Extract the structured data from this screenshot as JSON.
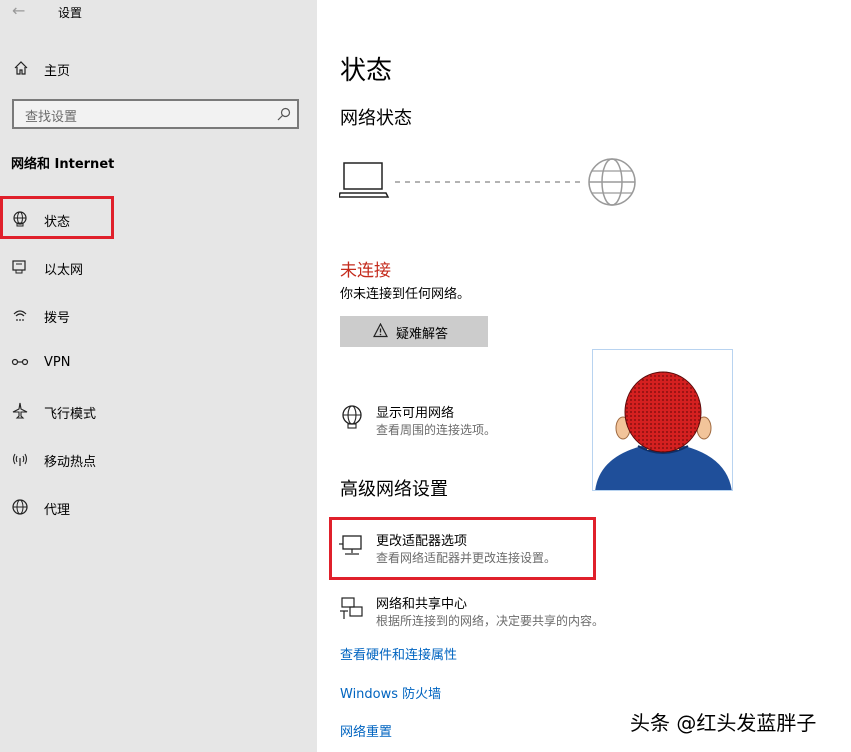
{
  "window": {
    "title": "设置"
  },
  "sidebar": {
    "home_label": "主页",
    "search_placeholder": "查找设置",
    "section_title": "网络和 Internet",
    "items": [
      {
        "label": "状态",
        "icon": "globe-icon"
      },
      {
        "label": "以太网",
        "icon": "ethernet-icon"
      },
      {
        "label": "拨号",
        "icon": "dialup-icon"
      },
      {
        "label": "VPN",
        "icon": "vpn-icon"
      },
      {
        "label": "飞行模式",
        "icon": "airplane-icon"
      },
      {
        "label": "移动热点",
        "icon": "hotspot-icon"
      },
      {
        "label": "代理",
        "icon": "globe-icon"
      }
    ]
  },
  "main": {
    "page_title": "状态",
    "network_status_heading": "网络状态",
    "status_text": "未连接",
    "status_desc": "你未连接到任何网络。",
    "troubleshoot_label": "疑难解答",
    "show_networks": {
      "title": "显示可用网络",
      "desc": "查看周围的连接选项。"
    },
    "advanced_heading": "高级网络设置",
    "adapter_options": {
      "title": "更改适配器选项",
      "desc": "查看网络适配器并更改连接设置。"
    },
    "sharing_center": {
      "title": "网络和共享中心",
      "desc": "根据所连接到的网络，决定要共享的内容。"
    },
    "links": [
      "查看硬件和连接属性",
      "Windows 防火墙",
      "网络重置"
    ]
  },
  "watermark": "头条 @红头发蓝胖子",
  "colors": {
    "error": "#c42b1c",
    "link": "#0064c0",
    "highlight": "#e0202b",
    "sidebar_bg": "#e6e6e6"
  }
}
